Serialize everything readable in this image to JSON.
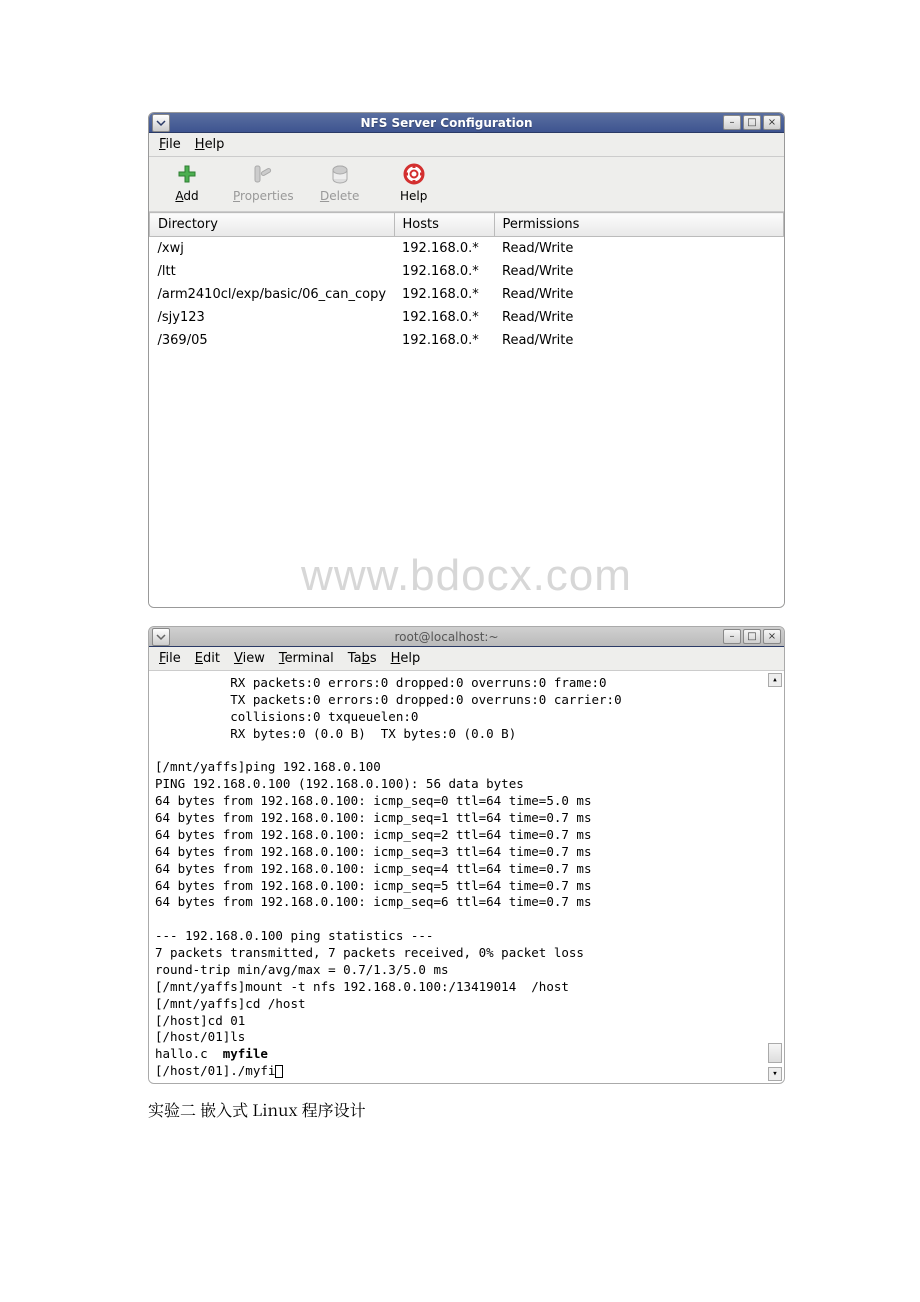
{
  "nfs_window": {
    "title": "NFS Server Configuration",
    "menu": {
      "file": "File",
      "help": "Help"
    },
    "toolbar": {
      "add": "Add",
      "properties": "Properties",
      "delete": "Delete",
      "helpbtn": "Help"
    },
    "columns": {
      "dir": "Directory",
      "hosts": "Hosts",
      "perm": "Permissions"
    },
    "rows": [
      {
        "dir": "/xwj",
        "hosts": "192.168.0.*",
        "perm": "Read/Write"
      },
      {
        "dir": "/ltt",
        "hosts": "192.168.0.*",
        "perm": "Read/Write"
      },
      {
        "dir": "/arm2410cl/exp/basic/06_can_copy",
        "hosts": "192.168.0.*",
        "perm": "Read/Write"
      },
      {
        "dir": "/sjy123",
        "hosts": "192.168.0.*",
        "perm": "Read/Write"
      },
      {
        "dir": "/369/05",
        "hosts": "192.168.0.*",
        "perm": "Read/Write"
      }
    ],
    "watermark": "www.bdocx.com"
  },
  "terminal_window": {
    "title": "root@localhost:~",
    "menu": {
      "file": "File",
      "edit": "Edit",
      "view": "View",
      "terminal": "Terminal",
      "tabs": "Tabs",
      "help": "Help"
    },
    "lines_head": [
      "          RX packets:0 errors:0 dropped:0 overruns:0 frame:0",
      "          TX packets:0 errors:0 dropped:0 overruns:0 carrier:0",
      "          collisions:0 txqueuelen:0",
      "          RX bytes:0 (0.0 B)  TX bytes:0 (0.0 B)",
      "",
      "[/mnt/yaffs]ping 192.168.0.100",
      "PING 192.168.0.100 (192.168.0.100): 56 data bytes",
      "64 bytes from 192.168.0.100: icmp_seq=0 ttl=64 time=5.0 ms",
      "64 bytes from 192.168.0.100: icmp_seq=1 ttl=64 time=0.7 ms",
      "64 bytes from 192.168.0.100: icmp_seq=2 ttl=64 time=0.7 ms",
      "64 bytes from 192.168.0.100: icmp_seq=3 ttl=64 time=0.7 ms",
      "64 bytes from 192.168.0.100: icmp_seq=4 ttl=64 time=0.7 ms",
      "64 bytes from 192.168.0.100: icmp_seq=5 ttl=64 time=0.7 ms",
      "64 bytes from 192.168.0.100: icmp_seq=6 ttl=64 time=0.7 ms",
      "",
      "--- 192.168.0.100 ping statistics ---",
      "7 packets transmitted, 7 packets received, 0% packet loss",
      "round-trip min/avg/max = 0.7/1.3/5.0 ms",
      "[/mnt/yaffs]mount -t nfs 192.168.0.100:/13419014  /host",
      "[/mnt/yaffs]cd /host",
      "[/host]cd 01",
      "[/host/01]ls"
    ],
    "ls_plain": "hallo.c  ",
    "ls_bold": "myfile",
    "prompt_tail": "[/host/01]./myfi"
  },
  "caption": "实验二 嵌入式 Linux 程序设计"
}
